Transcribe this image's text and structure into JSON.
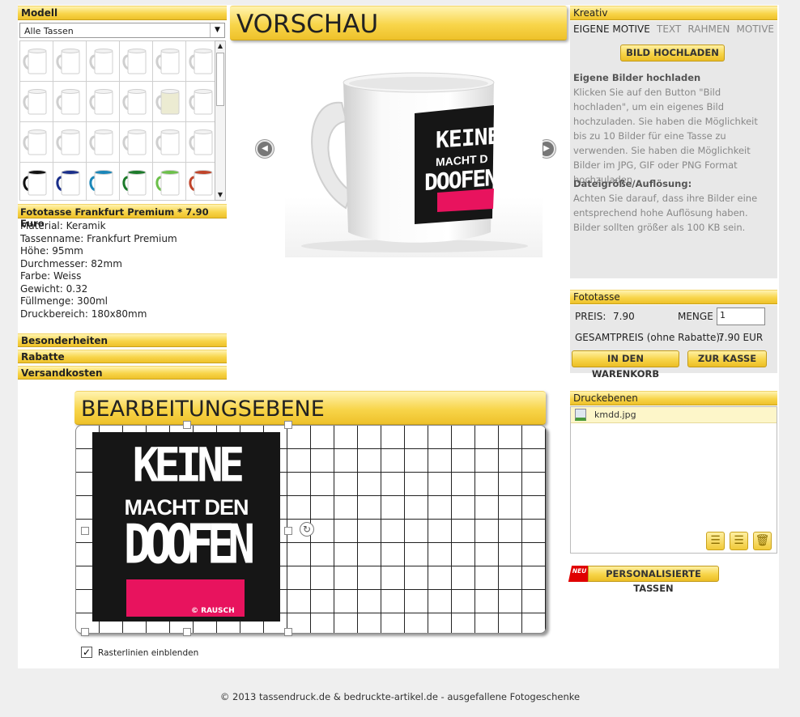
{
  "modell": {
    "title": "Modell",
    "select_value": "Alle Tassen"
  },
  "product": {
    "title": "Fototasse Frankfurt Premium * 7.90 Euro",
    "specs": [
      "Material: Keramik",
      "Tassenname: Frankfurt Premium",
      "Höhe: 95mm",
      "Durchmesser: 82mm",
      "Farbe: Weiss",
      "Gewicht: 0.32",
      "Füllmenge: 300ml",
      "Druckbereich: 180x80mm"
    ]
  },
  "accordion": {
    "besonderheiten": "Besonderheiten",
    "rabatte": "Rabatte",
    "versandkosten": "Versandkosten"
  },
  "preview": {
    "title": "VORSCHAU",
    "mug_text": {
      "line1": "KEINE",
      "line2": "MACHT D",
      "line3": "DOOFEN"
    }
  },
  "editor": {
    "title": "BEARBEITUNGSEBENE",
    "design_text": {
      "line1": "KEINE",
      "line2": "MACHT DEN",
      "line3": "DOOFEN",
      "copyright": "© RAUSCH"
    },
    "gridlines_label": "Rasterlinien einblenden",
    "gridlines_checked": true
  },
  "kreativ": {
    "title": "Kreativ",
    "tabs": [
      "EIGENE MOTIVE",
      "TEXT",
      "RAHMEN",
      "MOTIVE"
    ],
    "upload_button": "BILD HOCHLADEN",
    "section1_title": "Eigene Bilder hochladen",
    "section1_text": "Klicken Sie auf den Button \"Bild hochladen\", um ein eigenes Bild hochzuladen. Sie haben die Möglichkeit bis zu 10 Bilder für eine Tasse zu verwenden. Sie haben die Möglichkeit Bilder im JPG, GIF oder PNG Format hochzuladen.",
    "section2_title": "Dateigröße/Auflösung:",
    "section2_text": "Achten Sie darauf, dass ihre Bilder eine entsprechend hohe Auflösung haben. Bilder sollten größer als 100 KB sein."
  },
  "fototasse": {
    "title": "Fototasse",
    "price_label": "PREIS:",
    "price_value": "7.90",
    "qty_label": "MENGE",
    "qty_value": "1",
    "total_label": "GESAMTPREIS (ohne Rabatte):",
    "total_value": "7.90 EUR",
    "cart_button": "IN DEN WARENKORB",
    "checkout_button": "ZUR KASSE"
  },
  "druckebenen": {
    "title": "Druckebenen",
    "files": [
      "kmdd.jpg"
    ]
  },
  "personal": {
    "badge": "NEU",
    "label": "PERSONALISIERTE TASSEN"
  },
  "footer": {
    "text": "© 2013 tassendruck.de & bedruckte-artikel.de - ausgefallene Fotogeschenke"
  },
  "colors": {
    "accent_yellow": "#f8d54a",
    "panel_grey": "#e8e8e8",
    "design_pink": "#e8135e",
    "badge_red": "#e00000"
  }
}
